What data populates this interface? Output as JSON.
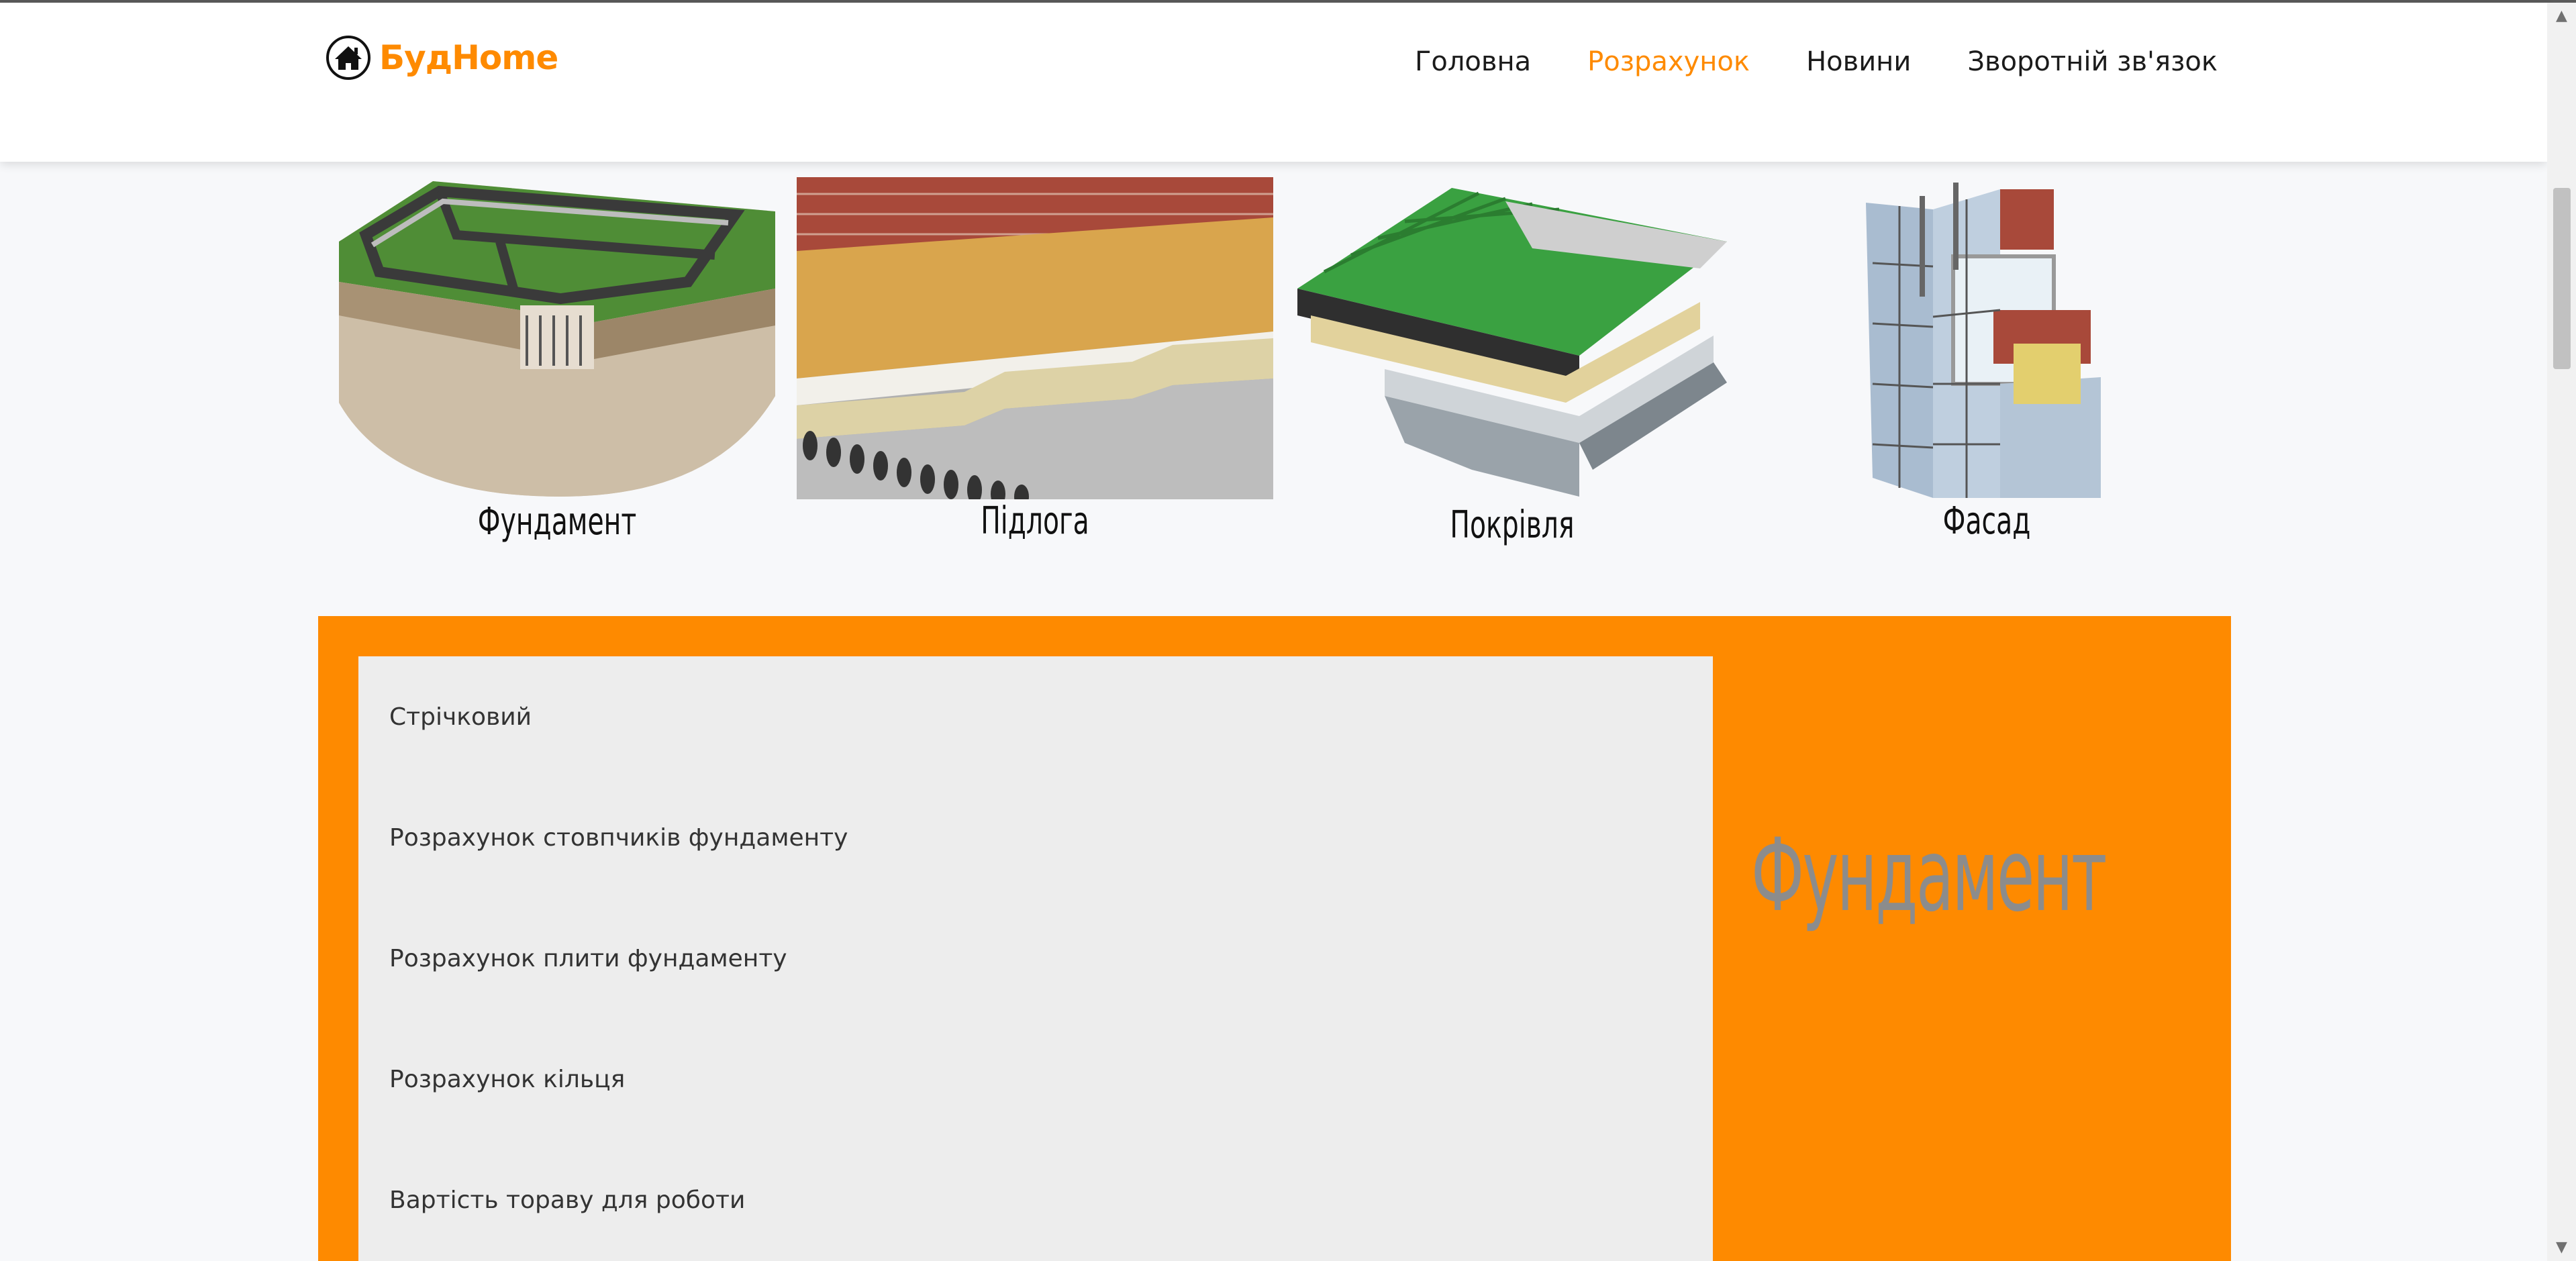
{
  "header": {
    "logo_text": "БудHome",
    "nav": [
      {
        "label": "Головна",
        "active": false
      },
      {
        "label": "Розрахунок",
        "active": true
      },
      {
        "label": "Новини",
        "active": false
      },
      {
        "label": "Зворотній зв'язок",
        "active": false
      }
    ]
  },
  "categories": [
    {
      "label": "Фундамент",
      "icon": "foundation-illustration"
    },
    {
      "label": "Підлога",
      "icon": "floor-illustration"
    },
    {
      "label": "Покрівля",
      "icon": "roof-illustration"
    },
    {
      "label": "Фасад",
      "icon": "facade-illustration"
    }
  ],
  "calc_menu": {
    "items": [
      "Стрічковий",
      "Розрахунок стовпчиків фундаменту",
      "Розрахунок плити фундаменту",
      "Розрахунок кільця",
      "Вартість тораву для роботи"
    ],
    "section_title": "Фундамент"
  },
  "colors": {
    "accent": "#fe8a00",
    "panel": "#ededed",
    "section_title": "#8c8c8c"
  }
}
